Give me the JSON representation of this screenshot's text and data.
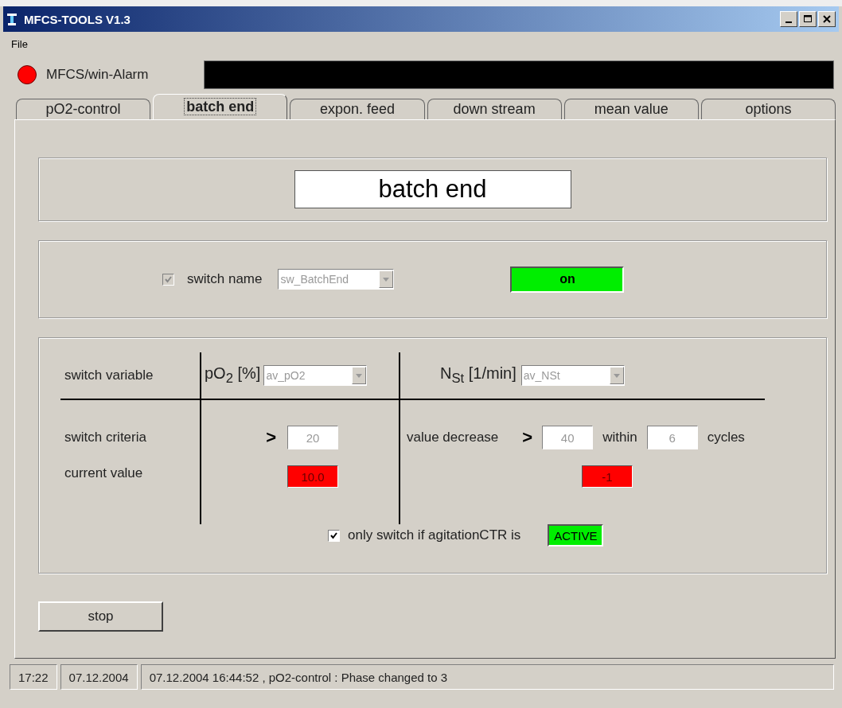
{
  "window": {
    "title": "MFCS-TOOLS V1.3"
  },
  "menu": [
    "File"
  ],
  "alarm": {
    "active": true,
    "label": "MFCS/win-Alarm"
  },
  "tabs": [
    {
      "label": "pO2-control",
      "selected": false
    },
    {
      "label": "batch end",
      "selected": true
    },
    {
      "label": "expon. feed",
      "selected": false
    },
    {
      "label": "down stream",
      "selected": false
    },
    {
      "label": "mean value",
      "selected": false
    },
    {
      "label": "options",
      "selected": false
    }
  ],
  "panel_title": "batch end",
  "switch": {
    "checked": true,
    "label": "switch name",
    "value": "sw_BatchEnd",
    "status": {
      "text": "on",
      "active": true
    }
  },
  "criteria": {
    "header_label": "switch variable",
    "columns": [
      {
        "heading": "pO$_{2}$ [%]",
        "select": "av_pO2"
      },
      {
        "heading": "N$_{St}$ [1/min]",
        "select": "av_NSt"
      }
    ],
    "criteria_label": "switch criteria",
    "current_label": "current value",
    "po2": {
      "operator": ">",
      "threshold": "20",
      "current": {
        "text": "10.0",
        "alarm": true
      }
    },
    "nst": {
      "label": "value decrease",
      "operator": ">",
      "threshold": "40",
      "within_label": "within",
      "cycles": "6",
      "cycles_label": "cycles",
      "current": {
        "text": "-1",
        "alarm": true
      }
    }
  },
  "agitation": {
    "checked": true,
    "label": "only switch if agitationCTR is",
    "status": {
      "text": "ACTIVE",
      "active": true
    }
  },
  "stop_button": "stop",
  "status_bar": [
    "17:22",
    "07.12.2004",
    "07.12.2004 16:44:52 ,  pO2-control : Phase changed to 3"
  ]
}
